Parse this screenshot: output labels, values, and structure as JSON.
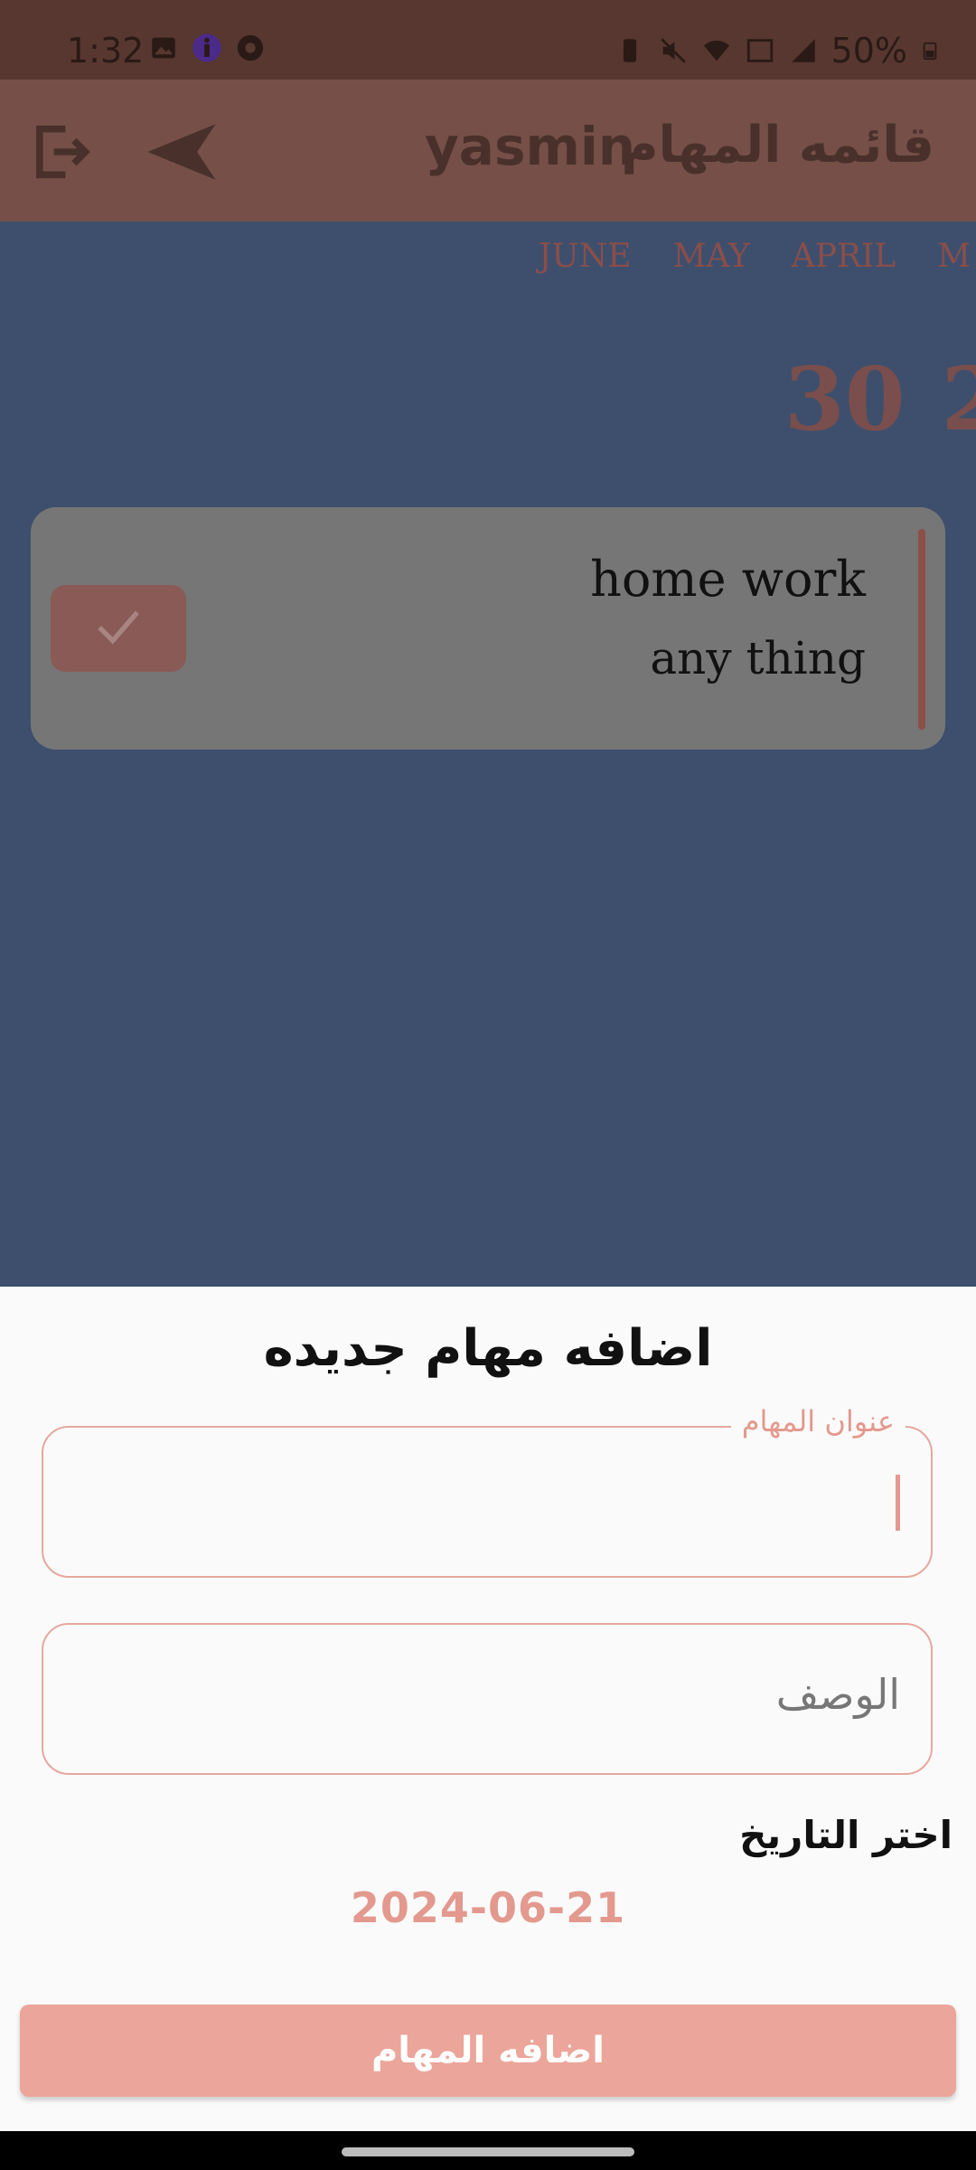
{
  "status_bar": {
    "time": "1:32",
    "battery": "50%",
    "left_icons": [
      "image-icon",
      "accessibility-icon",
      "chrome-icon"
    ],
    "right_icons": [
      "battery-saver-icon",
      "mute-icon",
      "wifi-icon",
      "volte-icon",
      "signal-icon",
      "battery-icon"
    ]
  },
  "app_bar": {
    "title": "قائمه المهام",
    "username": "yasmin",
    "icons": [
      "logout-icon",
      "send-icon"
    ]
  },
  "calendar": {
    "months": [
      "M",
      "APRIL",
      "MAY",
      "JUNE"
    ],
    "days": [
      "2",
      "30"
    ]
  },
  "tasks": [
    {
      "title": "home work",
      "description": "any thing",
      "done_icon": "check-icon"
    }
  ],
  "sheet": {
    "title": "اضافه مهام جديده",
    "title_field_label": "عنوان المهام",
    "description_placeholder": "الوصف",
    "date_label": "اختر التاريخ",
    "date_value": "2024-06-21",
    "submit_label": "اضافه المهام"
  },
  "colors": {
    "accent": "#E3998E",
    "button": "#EBA59A",
    "scrim_content": "#3E4F6D",
    "app_bar": "#754F48"
  }
}
